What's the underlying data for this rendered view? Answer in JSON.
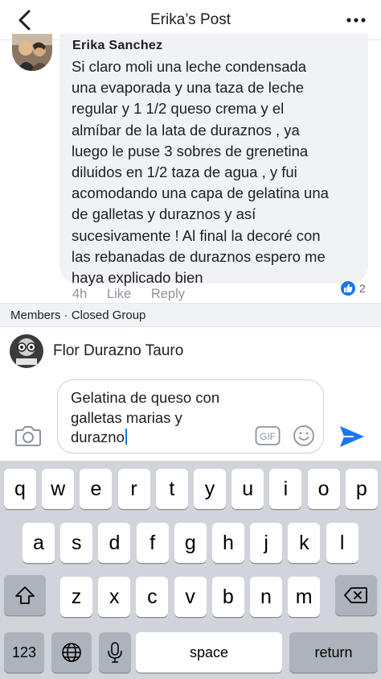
{
  "header": {
    "title": "Erika’s Post",
    "back_icon": "chevron-left-icon",
    "more_icon": "more-horizontal-icon"
  },
  "comment": {
    "author": "Erika Sanchez",
    "text": "Si claro moli una leche condensada\nuna evaporada y una taza de leche\nregular y 1 1/2  queso crema  y el\nalmíbar de la lata de duraznos , ya\nluego le puse 3 sobres de grenetina\ndiluidos en 1/2 taza de agua , y fui\nacomodando una capa de gelatina una\nde galletas y duraznos y así\nsucesivamente ! Al final la decoré con\nlas rebanadas de duraznos espero me\nhaya explicado bien",
    "time": "4h",
    "like_label": "Like",
    "reply_label": "Reply",
    "reaction_count": "2",
    "reaction_color": "#1877f2"
  },
  "group_bar": {
    "label": "Members · Closed Group"
  },
  "poster": {
    "name": "Flor Durazno Tauro"
  },
  "composer": {
    "text": "Gelatina de queso con\ngalletas marias y\ndurazno",
    "gif_label": "GIF",
    "send_color": "#1877f2"
  },
  "keyboard": {
    "row1": [
      "q",
      "w",
      "e",
      "r",
      "t",
      "y",
      "u",
      "i",
      "o",
      "p"
    ],
    "row2": [
      "a",
      "s",
      "d",
      "f",
      "g",
      "h",
      "j",
      "k",
      "l"
    ],
    "row3": [
      "z",
      "x",
      "c",
      "v",
      "b",
      "n",
      "m"
    ],
    "numbers_label": "123",
    "space_label": "space",
    "return_label": "return",
    "shift_icon": "shift-icon",
    "delete_icon": "backspace-icon",
    "globe_icon": "globe-icon",
    "mic_icon": "microphone-icon"
  }
}
